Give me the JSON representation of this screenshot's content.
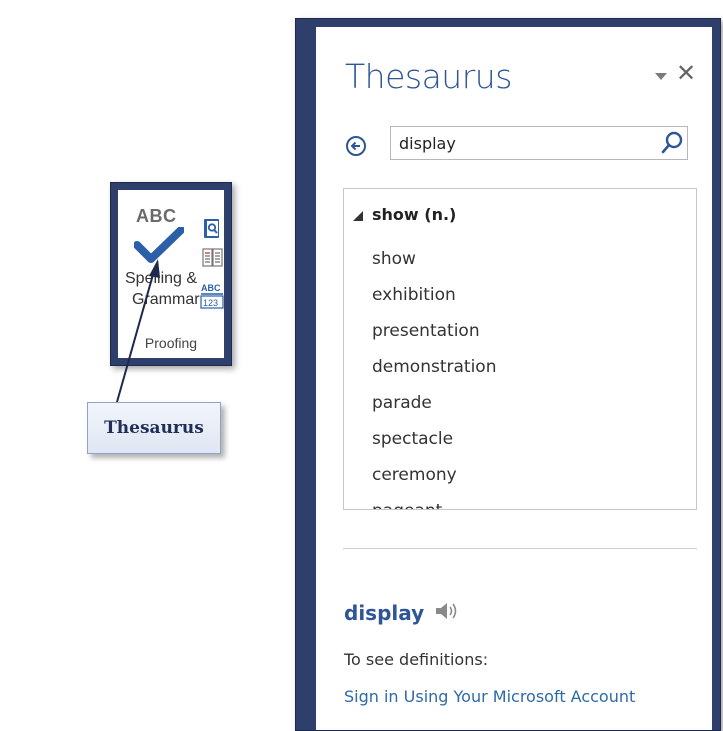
{
  "ribbon": {
    "big_button_icon_text": "ABC",
    "spelling_line1": "Spelling &",
    "spelling_line2": "Grammar",
    "group_label": "Proofing",
    "small_icons": [
      "research-icon",
      "thesaurus-icon",
      "word-count-icon"
    ],
    "word_count_icon_text_top": "ABC",
    "word_count_icon_text_bottom": "123"
  },
  "callout": {
    "label": "Thesaurus"
  },
  "pane": {
    "title": "Thesaurus",
    "search_value": "display",
    "group_heading": "show (n.)",
    "synonyms": [
      "show",
      "exhibition",
      "presentation",
      "demonstration",
      "parade",
      "spectacle",
      "ceremony",
      "pageant"
    ],
    "word": "display",
    "definitions_label": "To see definitions:",
    "signin_link": "Sign in Using Your Microsoft Account"
  },
  "colors": {
    "frame": "#2e3f6b",
    "accent": "#2e5596",
    "link": "#2e6aa8",
    "check": "#2b5fa8"
  }
}
